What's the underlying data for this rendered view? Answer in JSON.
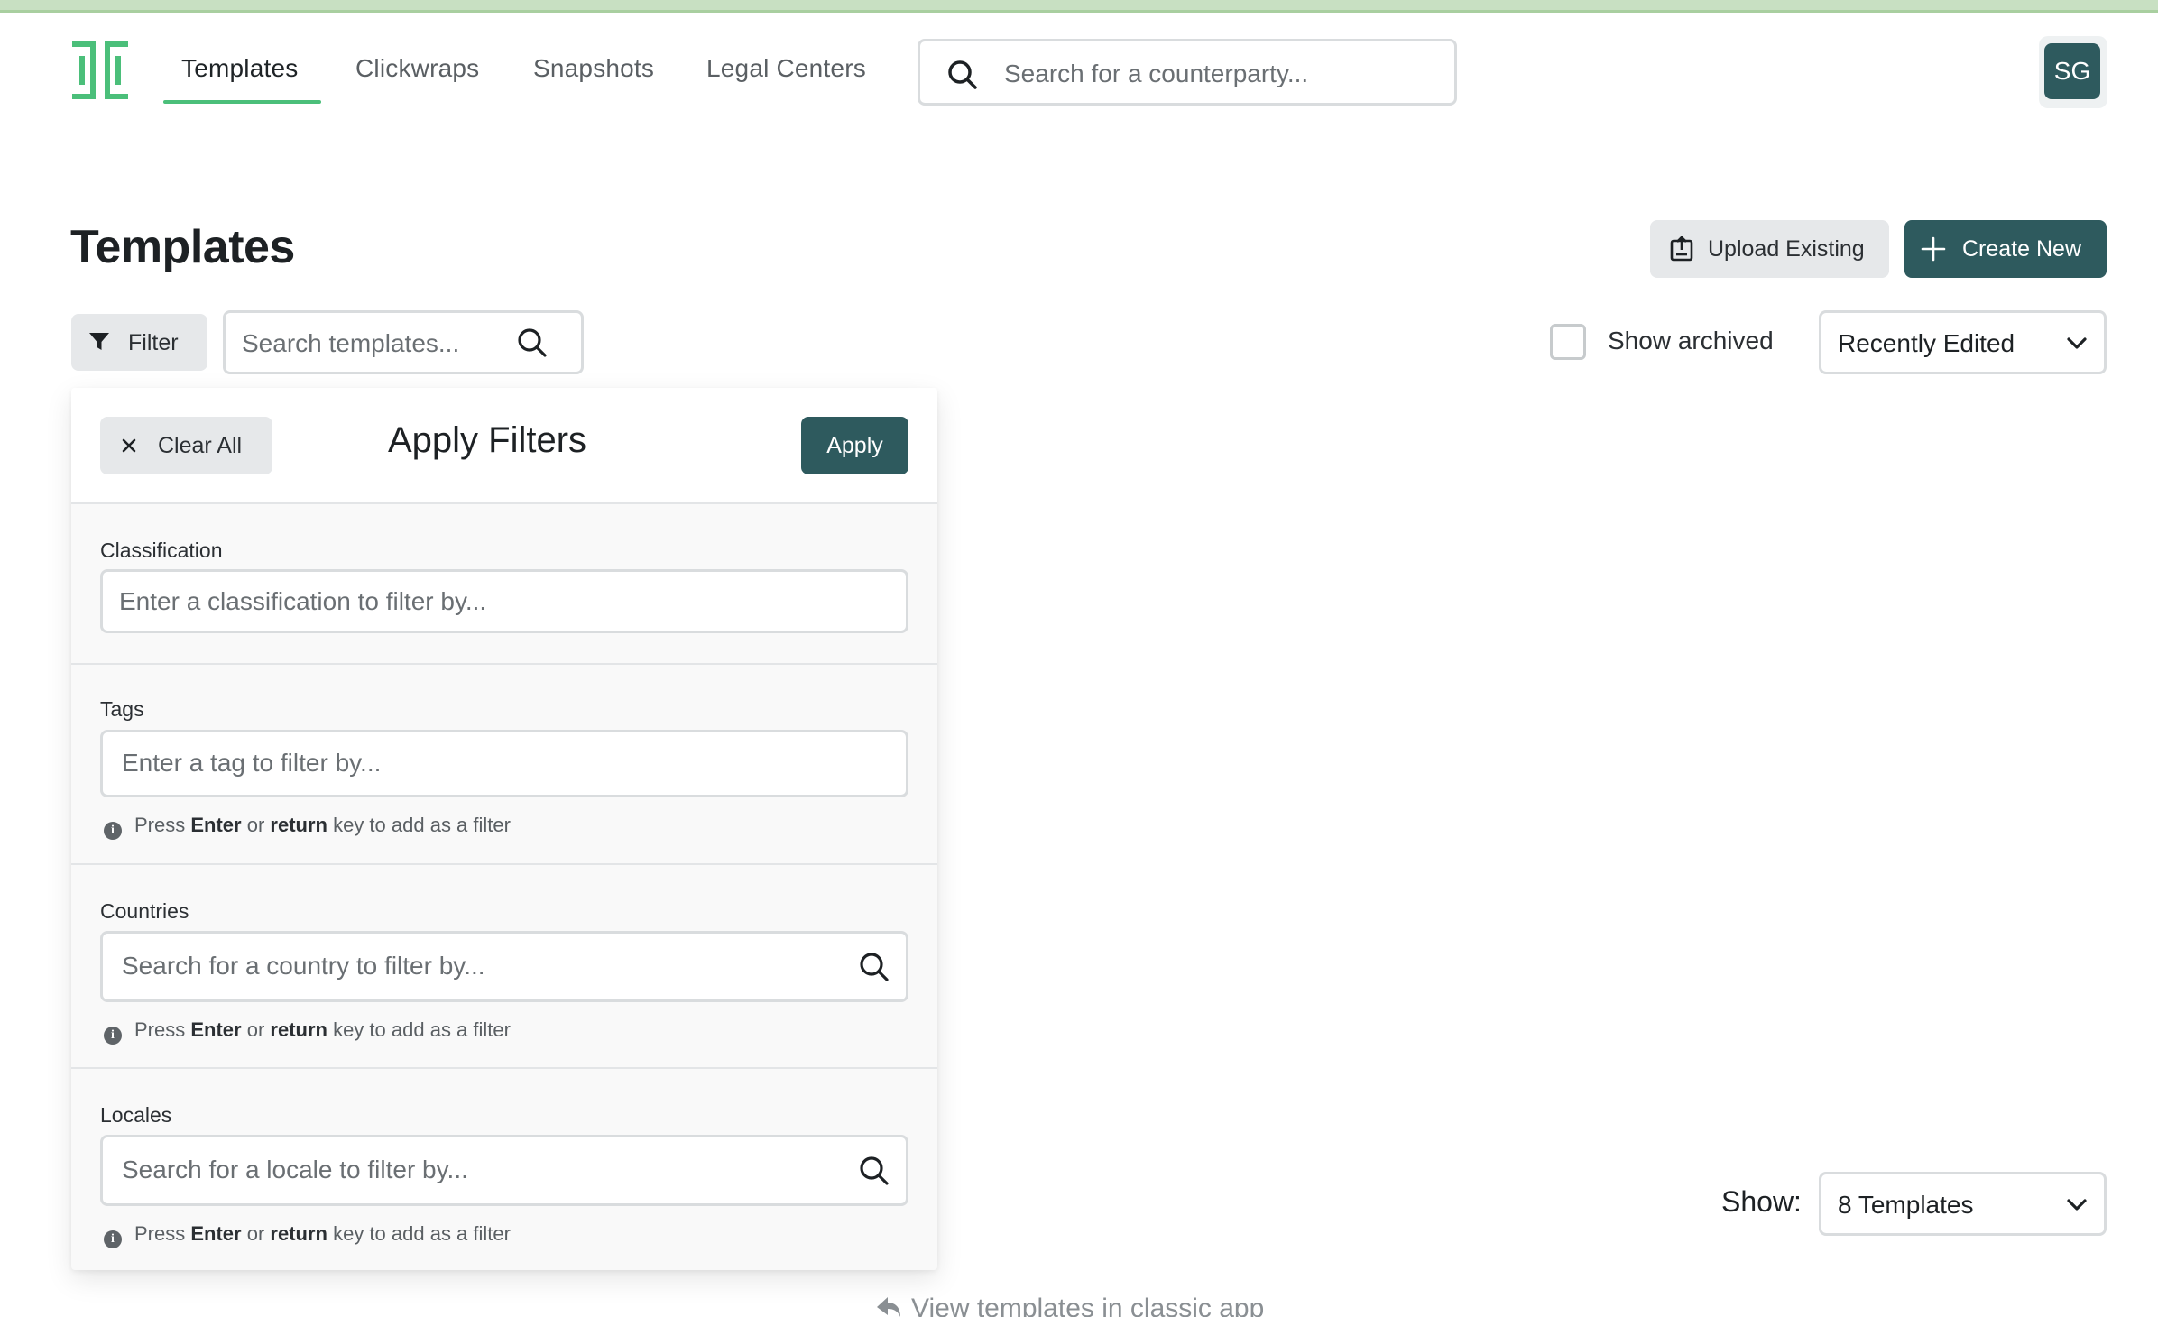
{
  "header": {
    "nav": [
      {
        "label": "Templates",
        "active": true
      },
      {
        "label": "Clickwraps",
        "active": false
      },
      {
        "label": "Snapshots",
        "active": false
      },
      {
        "label": "Legal Centers",
        "active": false
      }
    ],
    "search_placeholder": "Search for a counterparty...",
    "avatar_initials": "SG"
  },
  "page": {
    "title": "Templates",
    "upload_label": "Upload Existing",
    "create_label": "Create New"
  },
  "toolbar": {
    "filter_label": "Filter",
    "search_placeholder": "Search templates...",
    "show_archived_label": "Show archived",
    "show_archived_checked": false,
    "sort_value": "Recently Edited"
  },
  "filter_panel": {
    "clear_label": "Clear All",
    "title": "Apply Filters",
    "apply_label": "Apply",
    "sections": [
      {
        "label": "Classification",
        "placeholder": "Enter a classification to filter by..."
      },
      {
        "label": "Tags",
        "placeholder": "Enter a tag to filter by..."
      },
      {
        "label": "Countries",
        "placeholder": "Search for a country to filter by..."
      },
      {
        "label": "Locales",
        "placeholder": "Search for a locale to filter by..."
      }
    ],
    "hint": {
      "prefix": "Press ",
      "key1": "Enter",
      "mid": " or ",
      "key2": "return",
      "suffix": " key to add as a filter"
    }
  },
  "footer": {
    "show_label": "Show:",
    "show_value": "8 Templates",
    "classic_link": "View templates in classic app"
  },
  "colors": {
    "brand_dark": "#2e5a5e",
    "brand_green": "#4bbf7a",
    "top_bar": "#c8e0c2"
  },
  "icons": [
    "logo-icon",
    "search-icon",
    "upload-icon",
    "plus-icon",
    "filter-funnel-icon",
    "chevron-down-icon",
    "close-icon",
    "info-icon",
    "arrow-back-icon"
  ]
}
